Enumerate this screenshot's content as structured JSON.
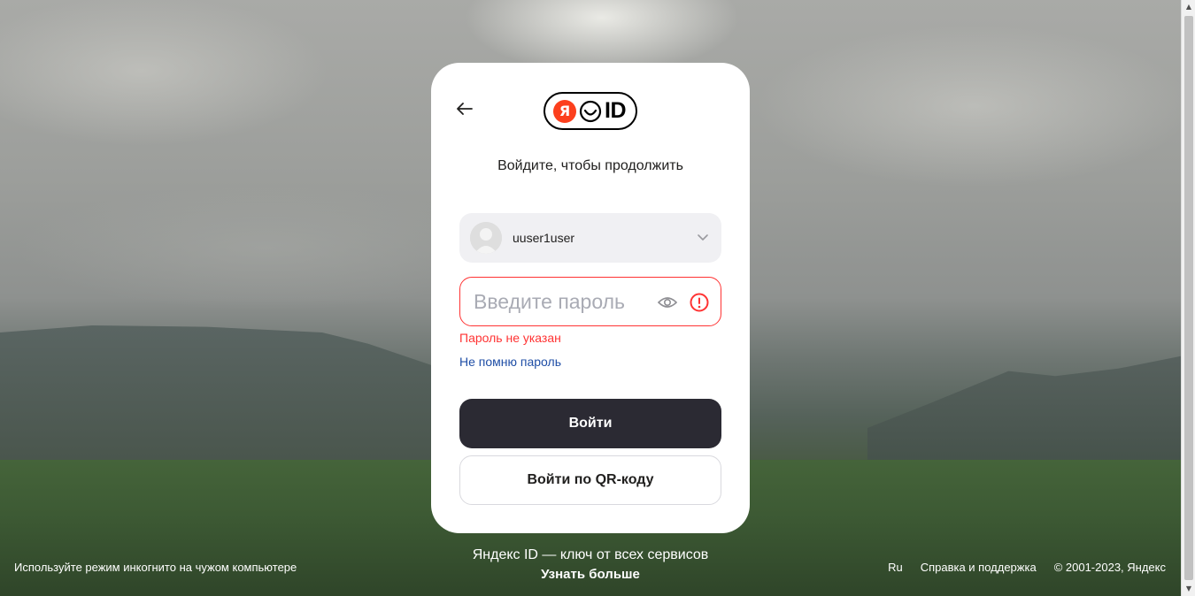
{
  "page": {
    "title": "Войдите, чтобы продолжить"
  },
  "logo": {
    "ya": "Я",
    "id": "ID"
  },
  "account": {
    "username": "uuser1user"
  },
  "password": {
    "placeholder": "Введите пароль",
    "value": "",
    "error": "Пароль не указан"
  },
  "links": {
    "forgot": "Не помню пароль"
  },
  "buttons": {
    "login": "Войти",
    "qr": "Войти по QR-коду"
  },
  "footer": {
    "incognito": "Используйте режим инкогнито на чужом компьютере",
    "tagline": "Яндекс ID — ключ от всех сервисов",
    "learn_more": "Узнать больше",
    "lang": "Ru",
    "help": "Справка и поддержка",
    "copyright": "© 2001-2023, Яндекс"
  },
  "colors": {
    "accent": "#fc3f1d",
    "error": "#ff3333",
    "primary_button": "#2b2a33",
    "link": "#1f4ea6"
  }
}
